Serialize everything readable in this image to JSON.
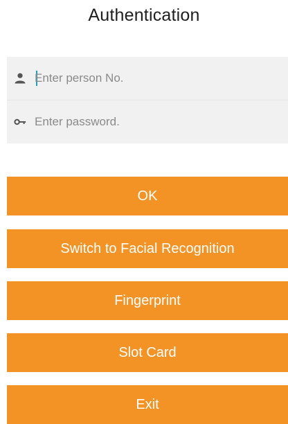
{
  "header": {
    "title": "Authentication"
  },
  "form": {
    "person_no": {
      "placeholder": "Enter person No.",
      "value": "",
      "icon": "person-icon"
    },
    "password": {
      "placeholder": "Enter password.",
      "value": "",
      "icon": "key-icon"
    }
  },
  "buttons": {
    "ok": "OK",
    "facial": "Switch to Facial Recognition",
    "fingerprint": "Fingerprint",
    "slot_card": "Slot Card",
    "exit": "Exit"
  },
  "colors": {
    "accent": "#f39325",
    "field_bg": "#f1f1f1",
    "cursor": "#1aa1c4",
    "title_text": "#1f1f1f",
    "icon": "#555555"
  }
}
